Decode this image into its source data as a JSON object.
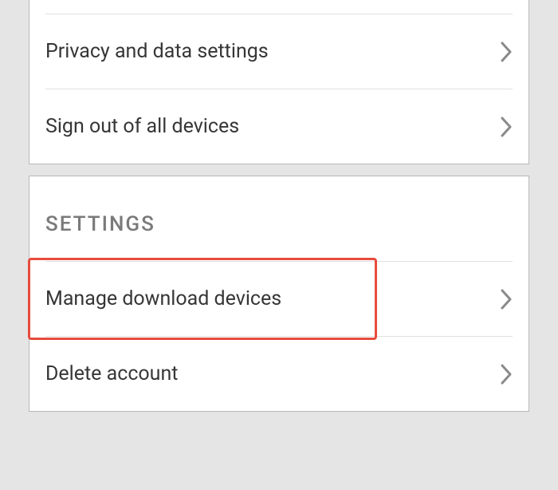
{
  "group1": {
    "items": [
      {
        "label": "Privacy and data settings"
      },
      {
        "label": "Sign out of all devices"
      }
    ]
  },
  "group2": {
    "header": "SETTINGS",
    "items": [
      {
        "label": "Manage download devices"
      },
      {
        "label": "Delete account"
      }
    ]
  }
}
